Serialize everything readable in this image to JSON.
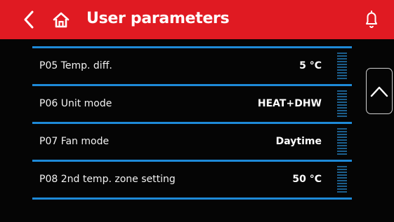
{
  "header": {
    "title": "User parameters",
    "back_icon": "chevron-left-icon",
    "home_icon": "home-icon",
    "bell_icon": "bell-icon",
    "color": "#e01a22"
  },
  "parameters": [
    {
      "label": "P05 Temp. diff.",
      "value": "5 °C"
    },
    {
      "label": "P06 Unit mode",
      "value": "HEAT+DHW"
    },
    {
      "label": "P07 Fan mode",
      "value": "Daytime"
    },
    {
      "label": "P08 2nd temp. zone setting",
      "value": "50 °C"
    }
  ],
  "scroll": {
    "up_icon": "chevron-up-icon"
  },
  "colors": {
    "accent": "#1e8ad8",
    "background": "#050505"
  }
}
